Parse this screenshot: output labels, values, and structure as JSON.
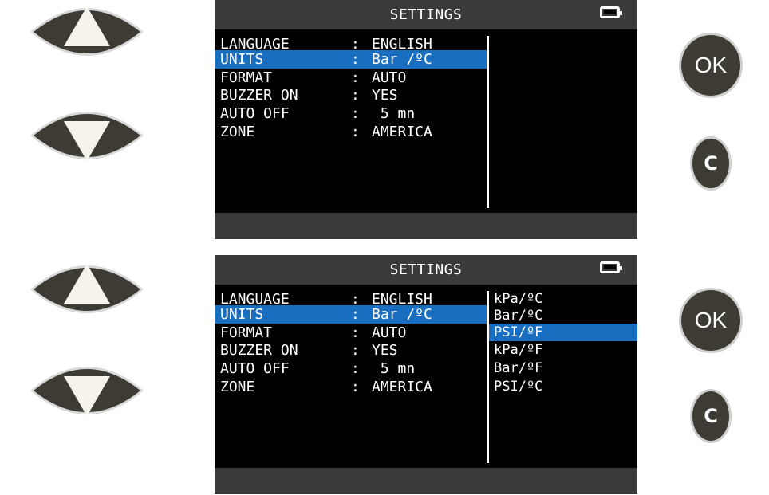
{
  "device_buttons": {
    "ok_label": "OK",
    "clear_label": "C"
  },
  "screens": [
    {
      "title": "SETTINGS",
      "rows": [
        {
          "label": "LANGUAGE",
          "sep": ":",
          "value": "ENGLISH"
        },
        {
          "label": "UNITS",
          "sep": ":",
          "value": "Bar /ºC"
        },
        {
          "label": "FORMAT",
          "sep": ":",
          "value": "AUTO"
        },
        {
          "label": "BUZZER ON",
          "sep": ":",
          "value": "YES"
        },
        {
          "label": "AUTO OFF",
          "sep": ":",
          "value": " 5 mn"
        },
        {
          "label": "ZONE",
          "sep": ":",
          "value": "AMERICA"
        }
      ],
      "selected_row": "UNITS",
      "options": []
    },
    {
      "title": "SETTINGS",
      "rows": [
        {
          "label": "LANGUAGE",
          "sep": ":",
          "value": "ENGLISH"
        },
        {
          "label": "UNITS",
          "sep": ":",
          "value": "Bar /ºC"
        },
        {
          "label": "FORMAT",
          "sep": ":",
          "value": "AUTO"
        },
        {
          "label": "BUZZER ON",
          "sep": ":",
          "value": "YES"
        },
        {
          "label": "AUTO OFF",
          "sep": ":",
          "value": " 5 mn"
        },
        {
          "label": "ZONE",
          "sep": ":",
          "value": "AMERICA"
        }
      ],
      "selected_row": "UNITS",
      "options": [
        "kPa/ºC",
        "Bar/ºC",
        "PSI/ºF",
        "kPa/ºF",
        "Bar/ºF",
        "PSI/ºC"
      ],
      "selected_option": "PSI/ºF"
    }
  ],
  "colors": {
    "highlight": "#1a6ec0",
    "screen_bg": "#000000",
    "bar_bg": "#3a3a3a",
    "button_dark": "#3d3b33"
  },
  "icons": {
    "up": "up-arrow-icon",
    "down": "down-arrow-icon",
    "battery": "battery-icon"
  }
}
